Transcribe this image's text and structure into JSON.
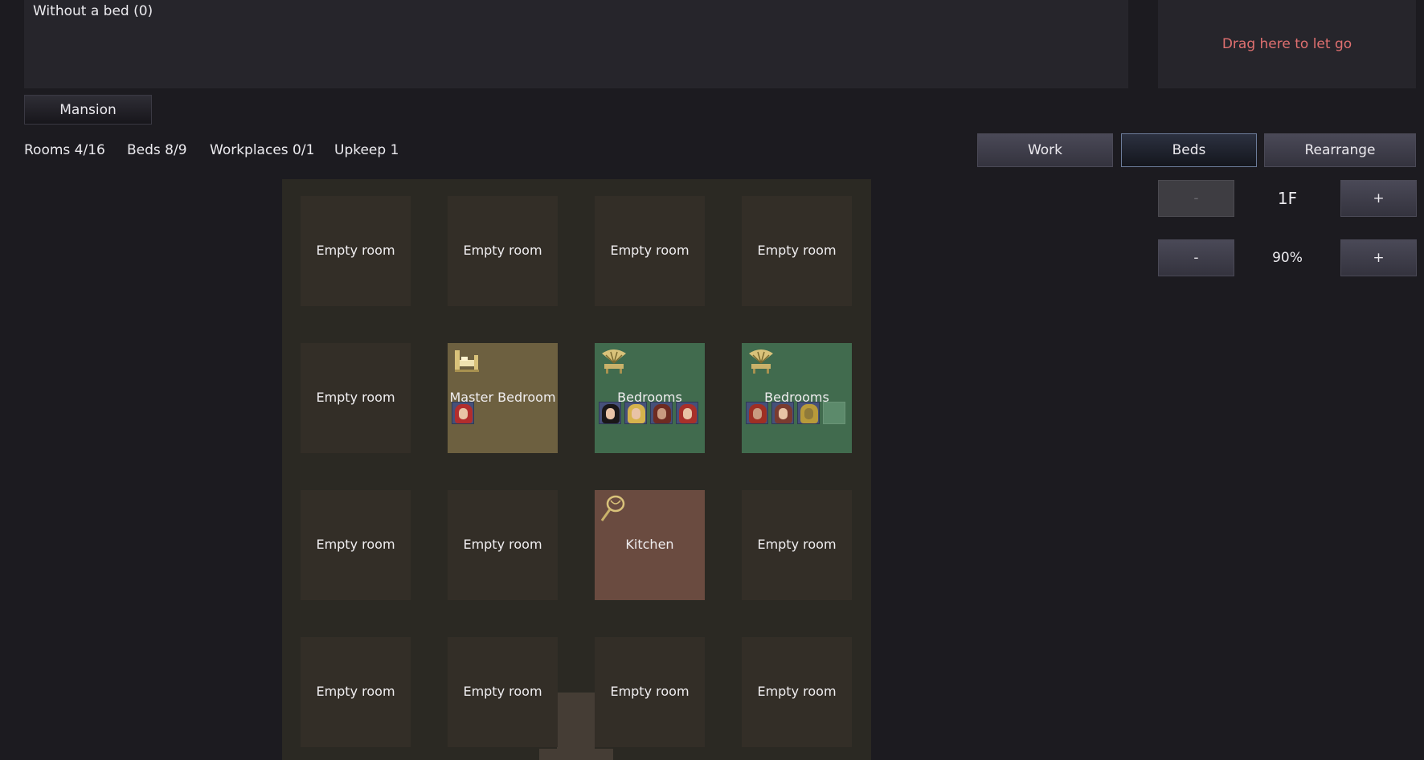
{
  "no_bed_panel": {
    "label": "Without a bed (0)"
  },
  "release_zone": {
    "label": "Drag here to let go"
  },
  "location_button": {
    "label": "Mansion"
  },
  "stats": {
    "rooms": "Rooms 4/16",
    "beds": "Beds 8/9",
    "workplaces": "Workplaces 0/1",
    "upkeep": "Upkeep 1"
  },
  "mode_tabs": {
    "work": "Work",
    "beds": "Beds",
    "rearrange": "Rearrange",
    "selected": "beds"
  },
  "floor_control": {
    "minus": "-",
    "value": "1F",
    "plus": "+"
  },
  "zoom_control": {
    "minus": "-",
    "value": "90%",
    "plus": "+"
  },
  "rooms": [
    {
      "label": "Empty room"
    },
    {
      "label": "Empty room"
    },
    {
      "label": "Empty room"
    },
    {
      "label": "Empty room"
    },
    {
      "label": "Empty room"
    },
    {
      "label": "Master Bedroom",
      "icon": "bed-icon",
      "occupants": [
        "red-haired-girl"
      ]
    },
    {
      "label": "Bedrooms",
      "icon": "fan-icon",
      "occupants": [
        "black-haired-girl",
        "blonde-girl",
        "bearded-man",
        "red-haired-woman"
      ]
    },
    {
      "label": "Bedrooms",
      "icon": "fan-icon",
      "occupants": [
        "red-bearded-man",
        "brown-haired-woman",
        "golden-creature"
      ],
      "empty_slots": 1
    },
    {
      "label": "Empty room"
    },
    {
      "label": "Empty room"
    },
    {
      "label": "Kitchen",
      "icon": "whisk-icon"
    },
    {
      "label": "Empty room"
    },
    {
      "label": "Empty room"
    },
    {
      "label": "Empty room"
    },
    {
      "label": "Empty room"
    },
    {
      "label": "Empty room"
    }
  ],
  "colors": {
    "background": "#1c1b20",
    "warning_text": "#e07070",
    "master_bedroom": "#6d6040",
    "bedrooms": "#416b4e",
    "kitchen": "#6a4b40",
    "empty_room": "#332e27"
  }
}
